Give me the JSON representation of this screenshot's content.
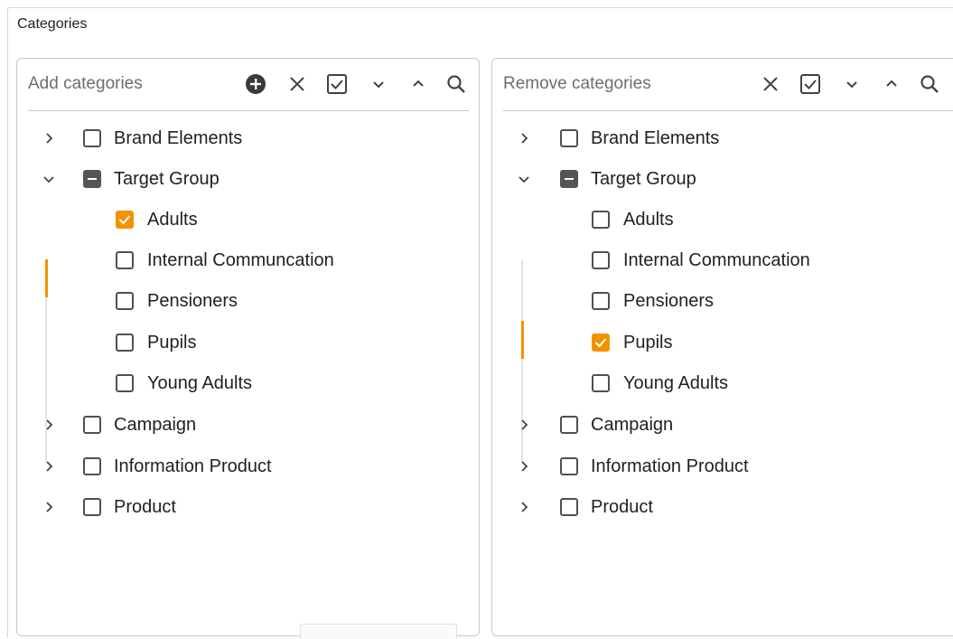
{
  "section_title": "Categories",
  "panels": [
    {
      "search_placeholder": "Add categories",
      "tools": [
        "add-icon",
        "close-icon",
        "check-all-icon",
        "chevron-down-icon",
        "chevron-up-icon",
        "search-icon"
      ],
      "items": [
        {
          "label": "Brand Elements",
          "level": 0,
          "expander": "collapsed",
          "state": "unchecked"
        },
        {
          "label": "Target Group",
          "level": 0,
          "expander": "expanded",
          "state": "indeterminate"
        },
        {
          "label": "Adults",
          "level": 1,
          "expander": "none",
          "state": "checked"
        },
        {
          "label": "Internal Communcation",
          "level": 1,
          "expander": "none",
          "state": "unchecked"
        },
        {
          "label": "Pensioners",
          "level": 1,
          "expander": "none",
          "state": "unchecked"
        },
        {
          "label": "Pupils",
          "level": 1,
          "expander": "none",
          "state": "unchecked"
        },
        {
          "label": "Young Adults",
          "level": 1,
          "expander": "none",
          "state": "unchecked"
        },
        {
          "label": "Campaign",
          "level": 0,
          "expander": "collapsed",
          "state": "unchecked"
        },
        {
          "label": "Information Product",
          "level": 0,
          "expander": "collapsed",
          "state": "unchecked"
        },
        {
          "label": "Product",
          "level": 0,
          "expander": "collapsed",
          "state": "unchecked"
        }
      ]
    },
    {
      "search_placeholder": "Remove categories",
      "tools": [
        "close-icon",
        "check-all-icon",
        "chevron-down-icon",
        "chevron-up-icon",
        "search-icon"
      ],
      "items": [
        {
          "label": "Brand Elements",
          "level": 0,
          "expander": "collapsed",
          "state": "unchecked"
        },
        {
          "label": "Target Group",
          "level": 0,
          "expander": "expanded",
          "state": "indeterminate"
        },
        {
          "label": "Adults",
          "level": 1,
          "expander": "none",
          "state": "unchecked"
        },
        {
          "label": "Internal Communcation",
          "level": 1,
          "expander": "none",
          "state": "unchecked"
        },
        {
          "label": "Pensioners",
          "level": 1,
          "expander": "none",
          "state": "unchecked"
        },
        {
          "label": "Pupils",
          "level": 1,
          "expander": "none",
          "state": "checked"
        },
        {
          "label": "Young Adults",
          "level": 1,
          "expander": "none",
          "state": "unchecked"
        },
        {
          "label": "Campaign",
          "level": 0,
          "expander": "collapsed",
          "state": "unchecked"
        },
        {
          "label": "Information Product",
          "level": 0,
          "expander": "collapsed",
          "state": "unchecked"
        },
        {
          "label": "Product",
          "level": 0,
          "expander": "collapsed",
          "state": "unchecked"
        }
      ]
    }
  ],
  "colors": {
    "accent": "#f39200",
    "icon": "#424242",
    "border": "#c8c8c8"
  }
}
